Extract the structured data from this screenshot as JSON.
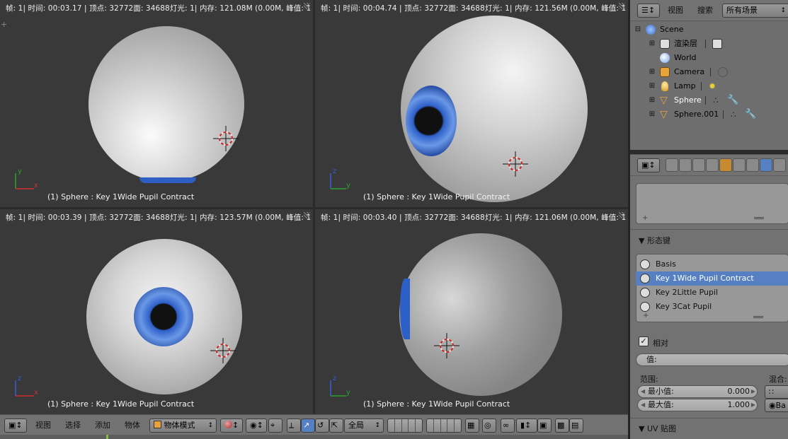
{
  "viewports": [
    {
      "info": "帧: 1| 时间: 00:03.17 | 顶点: 32772面: 34688灯光: 1| 内存: 121.08M (0.00M, 峰值: 1",
      "label": "(1) Sphere : Key 1Wide Pupil Contract",
      "axes": [
        "y",
        "x"
      ]
    },
    {
      "info": "帧: 1| 时间: 00:04.74 | 顶点: 32772面: 34688灯光: 1| 内存: 121.56M (0.00M, 峰值: 1",
      "label": "(1) Sphere : Key 1Wide Pupil Contract",
      "axes": [
        "z",
        "y"
      ]
    },
    {
      "info": "帧: 1| 时间: 00:03.39 | 顶点: 32772面: 34688灯光: 1| 内存: 123.57M (0.00M, 峰值: 1",
      "label": "(1) Sphere : Key 1Wide Pupil Contract",
      "axes": [
        "z",
        "x"
      ]
    },
    {
      "info": "帧: 1| 时间: 00:03.40 | 顶点: 32772面: 34688灯光: 1| 内存: 121.06M (0.00M, 峰值: 1",
      "label": "(1) Sphere : Key 1Wide Pupil Contract",
      "axes": [
        "z",
        "y"
      ]
    }
  ],
  "header3d": {
    "menu_view": "视图",
    "menu_select": "选择",
    "menu_add": "添加",
    "menu_object": "物体",
    "mode": "物体模式",
    "orientation": "全局"
  },
  "outliner": {
    "menu_view": "视图",
    "menu_search": "搜索",
    "scene_filter": "所有场景",
    "tree": [
      {
        "label": "Scene",
        "icon": "scene-icon"
      },
      {
        "label": "渲染层",
        "icon": "render-layers-icon"
      },
      {
        "label": "World",
        "icon": "world-icon"
      },
      {
        "label": "Camera",
        "icon": "camera-icon"
      },
      {
        "label": "Lamp",
        "icon": "lamp-icon"
      },
      {
        "label": "Sphere",
        "icon": "mesh-icon"
      },
      {
        "label": "Sphere.001",
        "icon": "mesh-icon"
      }
    ]
  },
  "properties": {
    "shape_keys_title": "形态键",
    "shape_keys": [
      "Basis",
      "Key 1Wide Pupil Contract",
      "Key 2Little Pupil",
      "Key 3Cat Pupil"
    ],
    "active_shape_key": 1,
    "relative_label": "相对",
    "relative_checked": true,
    "value_label": "值:",
    "range_label": "范围:",
    "blend_label": "混合:",
    "min_label": "最小值:",
    "min_value": "0.000",
    "max_label": "最大值:",
    "max_value": "1.000",
    "blend_value": "Ba",
    "uv_title": "UV 贴图"
  },
  "colors": {
    "accent": "#5680c2",
    "viewport_bg": "#393939",
    "iris": "#2f5fc4"
  }
}
